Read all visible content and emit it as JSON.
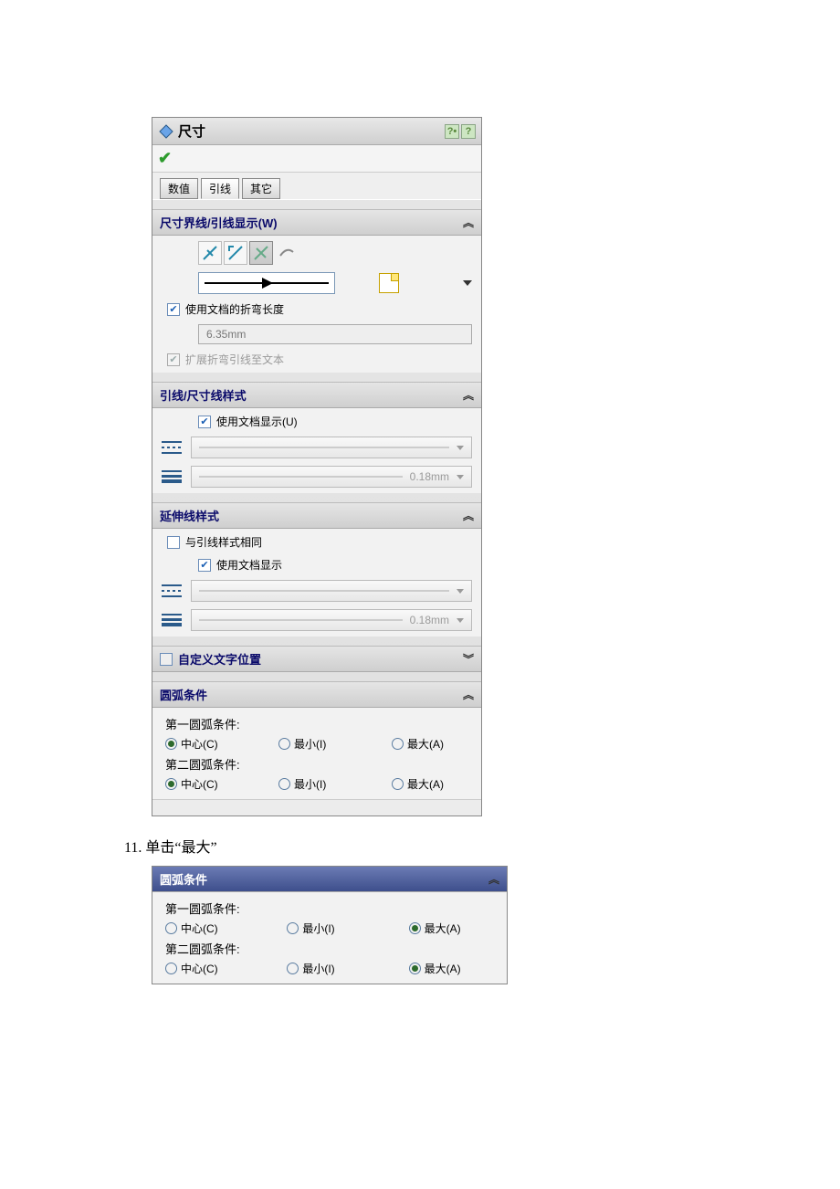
{
  "panel": {
    "title": "尺寸",
    "tabs": [
      "数值",
      "引线",
      "其它"
    ],
    "active_tab": 1,
    "sec1": {
      "header": "尺寸界线/引线显示(W)",
      "use_doc_bend": "使用文档的折弯长度",
      "bend_value": "6.35mm",
      "extend_bent": "扩展折弯引线至文本"
    },
    "sec2": {
      "header": "引线/尺寸线样式",
      "use_doc_display": "使用文档显示(U)",
      "thickness_value": "0.18mm"
    },
    "sec3": {
      "header": "延伸线样式",
      "same_as_leader": "与引线样式相同",
      "use_doc_display": "使用文档显示",
      "thickness_value": "0.18mm"
    },
    "sec4": {
      "header": "自定义文字位置"
    },
    "sec5": {
      "header": "圆弧条件",
      "first_label": "第一圆弧条件:",
      "second_label": "第二圆弧条件:",
      "opts": {
        "center": "中心(C)",
        "min": "最小(I)",
        "max": "最大(A)"
      }
    }
  },
  "step": "11.  单击“最大”",
  "panel2": {
    "header": "圆弧条件",
    "first_label": "第一圆弧条件:",
    "second_label": "第二圆弧条件:",
    "opts": {
      "center": "中心(C)",
      "min": "最小(I)",
      "max": "最大(A)"
    }
  }
}
